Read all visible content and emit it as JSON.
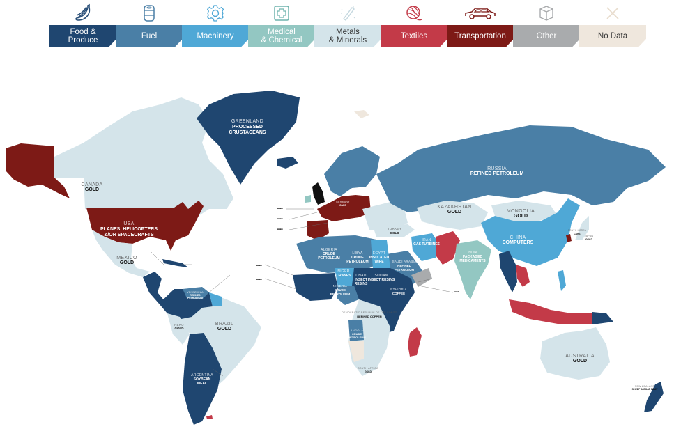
{
  "colors": {
    "food": "#1f4670",
    "fuel": "#4a7fa6",
    "machinery": "#4fa8d6",
    "medical": "#93c7c2",
    "metals": "#d4e4ea",
    "textiles": "#c33a48",
    "transportation": "#7d1a16",
    "other": "#a9abad",
    "nodata": "#efe7dd",
    "black": "#111111"
  },
  "legend": [
    {
      "key": "food",
      "icon": "banana-icon",
      "label_line1": "Food &",
      "label_line2": "Produce"
    },
    {
      "key": "fuel",
      "icon": "fuel-barrel-icon",
      "label_line1": "Fuel",
      "label_line2": ""
    },
    {
      "key": "machinery",
      "icon": "gear-icon",
      "label_line1": "Machinery",
      "label_line2": ""
    },
    {
      "key": "medical",
      "icon": "medical-cross-icon",
      "label_line1": "Medical",
      "label_line2": "& Chemical"
    },
    {
      "key": "metals",
      "icon": "metal-bar-icon",
      "label_line1": "Metals",
      "label_line2": "& Minerals"
    },
    {
      "key": "textiles",
      "icon": "yarn-ball-icon",
      "label_line1": "Textiles",
      "label_line2": ""
    },
    {
      "key": "transportation",
      "icon": "car-icon",
      "label_line1": "Transportation",
      "label_line2": ""
    },
    {
      "key": "other",
      "icon": "box-icon",
      "label_line1": "Other",
      "label_line2": ""
    },
    {
      "key": "nodata",
      "icon": "x-icon",
      "label_line1": "No Data",
      "label_line2": ""
    }
  ],
  "countries": [
    {
      "name": "GREENLAND",
      "product_line1": "PROCESSED",
      "product_line2": "CRUSTACEANS",
      "category": "food"
    },
    {
      "name": "CANADA",
      "product_line1": "GOLD",
      "product_line2": "",
      "category": "metals"
    },
    {
      "name": "USA",
      "product_line1": "PLANES, HELICOPTERS",
      "product_line2": "&/OR SPACECRAFTS",
      "category": "transportation"
    },
    {
      "name": "MEXICO",
      "product_line1": "GOLD",
      "product_line2": "",
      "category": "metals"
    },
    {
      "name": "RUSSIA",
      "product_line1": "REFINED PETROLEUM",
      "product_line2": "",
      "category": "fuel"
    },
    {
      "name": "KAZAKHSTAN",
      "product_line1": "GOLD",
      "product_line2": "",
      "category": "metals"
    },
    {
      "name": "MONGOLIA",
      "product_line1": "GOLD",
      "product_line2": "",
      "category": "metals"
    },
    {
      "name": "CHINA",
      "product_line1": "COMPUTERS",
      "product_line2": "",
      "category": "machinery"
    },
    {
      "name": "IRAN",
      "product_line1": "GAS TURBINES",
      "product_line2": "",
      "category": "machinery"
    },
    {
      "name": "INDIA",
      "product_line1": "PACKAGED",
      "product_line2": "MEDICAMENTS",
      "category": "medical"
    },
    {
      "name": "ALGERIA",
      "product_line1": "CRUDE",
      "product_line2": "PETROLEUM",
      "category": "fuel"
    },
    {
      "name": "LIBYA",
      "product_line1": "CRUDE",
      "product_line2": "PETROLEUM",
      "category": "fuel"
    },
    {
      "name": "EGYPT",
      "product_line1": "INSULATED",
      "product_line2": "WIRE",
      "category": "machinery"
    },
    {
      "name": "SAUDI ARABIA",
      "product_line1": "REFINED",
      "product_line2": "PETROLEUM",
      "category": "fuel"
    },
    {
      "name": "NIGER",
      "product_line1": "CRANES",
      "product_line2": "",
      "category": "machinery"
    },
    {
      "name": "CHAD",
      "product_line1": "INSECT",
      "product_line2": "RESINS",
      "category": "food"
    },
    {
      "name": "SUDAN",
      "product_line1": "INSECT RESINS",
      "product_line2": "",
      "category": "food"
    },
    {
      "name": "NIGERIA",
      "product_line1": "CRUDE",
      "product_line2": "PETROLEUM",
      "category": "fuel"
    },
    {
      "name": "ETHIOPIA",
      "product_line1": "COFFEE",
      "product_line2": "",
      "category": "food"
    },
    {
      "name": "DEMOCRATIC REPUBLIC OF THE CONGO",
      "product_line1": "REFINED COPPER",
      "product_line2": "",
      "category": "metals"
    },
    {
      "name": "ANGOLA",
      "product_line1": "CRUDE",
      "product_line2": "PETROLEUM",
      "category": "fuel"
    },
    {
      "name": "SOUTH AFRICA",
      "product_line1": "GOLD",
      "product_line2": "",
      "category": "metals"
    },
    {
      "name": "BRAZIL",
      "product_line1": "GOLD",
      "product_line2": "",
      "category": "metals"
    },
    {
      "name": "PERU",
      "product_line1": "GOLD",
      "product_line2": "",
      "category": "metals"
    },
    {
      "name": "ARGENTINA",
      "product_line1": "SOYBEAN",
      "product_line2": "MEAL",
      "category": "food"
    },
    {
      "name": "AUSTRALIA",
      "product_line1": "GOLD",
      "product_line2": "",
      "category": "metals"
    },
    {
      "name": "NEW ZEALAND",
      "product_line1": "SHEEP & GOAT MEAT",
      "product_line2": "",
      "category": "food"
    },
    {
      "name": "TURKEY",
      "product_line1": "GOLD",
      "product_line2": "",
      "category": "metals"
    },
    {
      "name": "GERMANY",
      "product_line1": "CARS",
      "product_line2": "",
      "category": "transportation"
    },
    {
      "name": "SOUTH KOREA",
      "product_line1": "CARS",
      "product_line2": "",
      "category": "transportation"
    },
    {
      "name": "JAPAN",
      "product_line1": "GOLD",
      "product_line2": "",
      "category": "metals"
    },
    {
      "name": "VENEZUELA",
      "product_line1": "REFINED",
      "product_line2": "PETROLEUM",
      "category": "fuel"
    }
  ]
}
